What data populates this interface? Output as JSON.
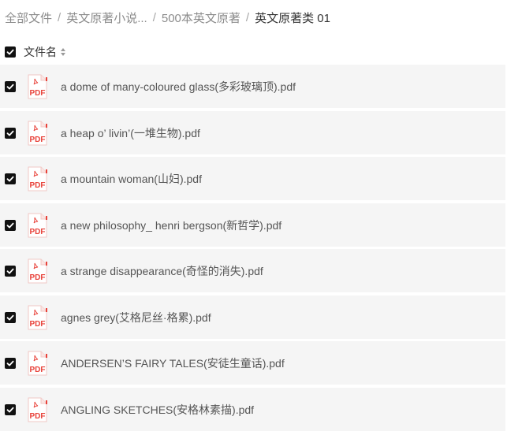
{
  "breadcrumb": {
    "items": [
      "全部文件",
      "英文原著小说...",
      "500本英文原著"
    ],
    "current": "英文原著类 01",
    "separator": "/"
  },
  "header": {
    "column_label": "文件名",
    "select_all_checked": true
  },
  "files": [
    {
      "name": "a dome of many-coloured glass(多彩玻璃顶).pdf",
      "checked": true,
      "icon": "pdf-file-icon"
    },
    {
      "name": "a heap o’   livin’(一堆生物).pdf",
      "checked": true,
      "icon": "pdf-file-icon"
    },
    {
      "name": "a mountain woman(山妇).pdf",
      "checked": true,
      "icon": "pdf-file-icon"
    },
    {
      "name": "a new philosophy_ henri bergson(新哲学).pdf",
      "checked": true,
      "icon": "pdf-file-icon"
    },
    {
      "name": "a strange disappearance(奇怪的消失).pdf",
      "checked": true,
      "icon": "pdf-file-icon"
    },
    {
      "name": "agnes grey(艾格尼丝·格累).pdf",
      "checked": true,
      "icon": "pdf-file-icon"
    },
    {
      "name": "ANDERSEN’S FAIRY TALES(安徒生童话).pdf",
      "checked": true,
      "icon": "pdf-file-icon"
    },
    {
      "name": "ANGLING SKETCHES(安格林素描).pdf",
      "checked": true,
      "icon": "pdf-file-icon"
    }
  ],
  "icon_text": {
    "pdf": "PDF"
  },
  "colors": {
    "row_bg": "#f5f5f5",
    "checkbox": "#111111",
    "pdf_red": "#e8423a"
  }
}
